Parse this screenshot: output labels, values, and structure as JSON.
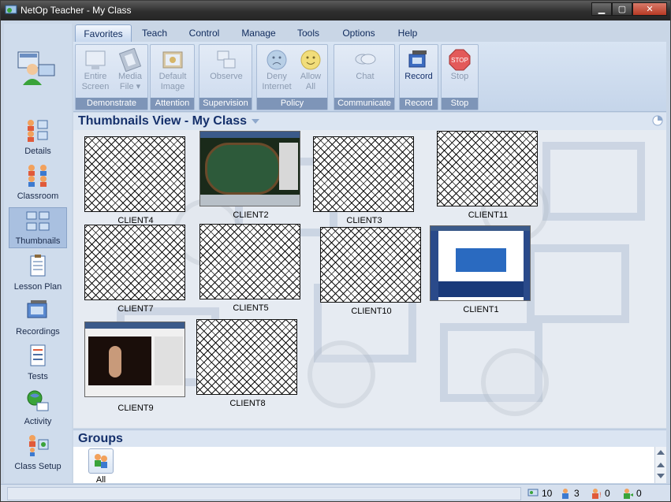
{
  "window": {
    "title": "NetOp Teacher - My Class",
    "controls": [
      "minimize",
      "maximize",
      "close"
    ]
  },
  "sidebar": {
    "items": [
      {
        "label": "Details",
        "icon": "details-icon"
      },
      {
        "label": "Classroom",
        "icon": "classroom-icon"
      },
      {
        "label": "Thumbnails",
        "icon": "thumbnails-icon",
        "active": true
      },
      {
        "label": "Lesson Plan",
        "icon": "lesson-plan-icon"
      },
      {
        "label": "Recordings",
        "icon": "recordings-icon"
      },
      {
        "label": "Tests",
        "icon": "tests-icon"
      },
      {
        "label": "Activity",
        "icon": "activity-icon"
      },
      {
        "label": "Class Setup",
        "icon": "class-setup-icon"
      }
    ]
  },
  "ribbon": {
    "tabs": [
      "Favorites",
      "Teach",
      "Control",
      "Manage",
      "Tools",
      "Options",
      "Help"
    ],
    "active_tab": "Favorites",
    "groups": [
      {
        "title": "Demonstrate",
        "buttons": [
          {
            "label": "Entire\nScreen",
            "enabled": false
          },
          {
            "label": "Media\nFile ▾",
            "enabled": false
          }
        ]
      },
      {
        "title": "Attention",
        "buttons": [
          {
            "label": "Default\nImage",
            "enabled": false
          }
        ]
      },
      {
        "title": "Supervision",
        "buttons": [
          {
            "label": "Observe",
            "enabled": false
          }
        ]
      },
      {
        "title": "Policy",
        "buttons": [
          {
            "label": "Deny\nInternet",
            "enabled": false
          },
          {
            "label": "Allow\nAll",
            "enabled": false
          }
        ]
      },
      {
        "title": "Communicate",
        "buttons": [
          {
            "label": "Chat",
            "enabled": false
          }
        ]
      },
      {
        "title": "Record",
        "buttons": [
          {
            "label": "Record",
            "enabled": true
          }
        ]
      },
      {
        "title": "Stop",
        "buttons": [
          {
            "label": "Stop",
            "enabled": false
          }
        ]
      }
    ]
  },
  "view": {
    "title": "Thumbnails View - My Class"
  },
  "thumbnails": [
    {
      "name": "CLIENT4",
      "state": "no-image"
    },
    {
      "name": "CLIENT2",
      "state": "screenshot"
    },
    {
      "name": "CLIENT3",
      "state": "no-image"
    },
    {
      "name": "CLIENT11",
      "state": "no-image"
    },
    {
      "name": "CLIENT7",
      "state": "no-image"
    },
    {
      "name": "CLIENT5",
      "state": "no-image"
    },
    {
      "name": "CLIENT10",
      "state": "no-image"
    },
    {
      "name": "CLIENT1",
      "state": "screenshot"
    },
    {
      "name": "CLIENT9",
      "state": "screenshot"
    },
    {
      "name": "CLIENT8",
      "state": "no-image"
    }
  ],
  "groups": {
    "title": "Groups",
    "items": [
      {
        "label": "All"
      }
    ]
  },
  "status": {
    "computers": "10",
    "students": "3",
    "attention": "0",
    "help_requests": "0"
  },
  "colors": {
    "accent": "#15306b",
    "group_title_bg": "#7e95b8",
    "ribbon_bg": "#c5d5ea"
  }
}
